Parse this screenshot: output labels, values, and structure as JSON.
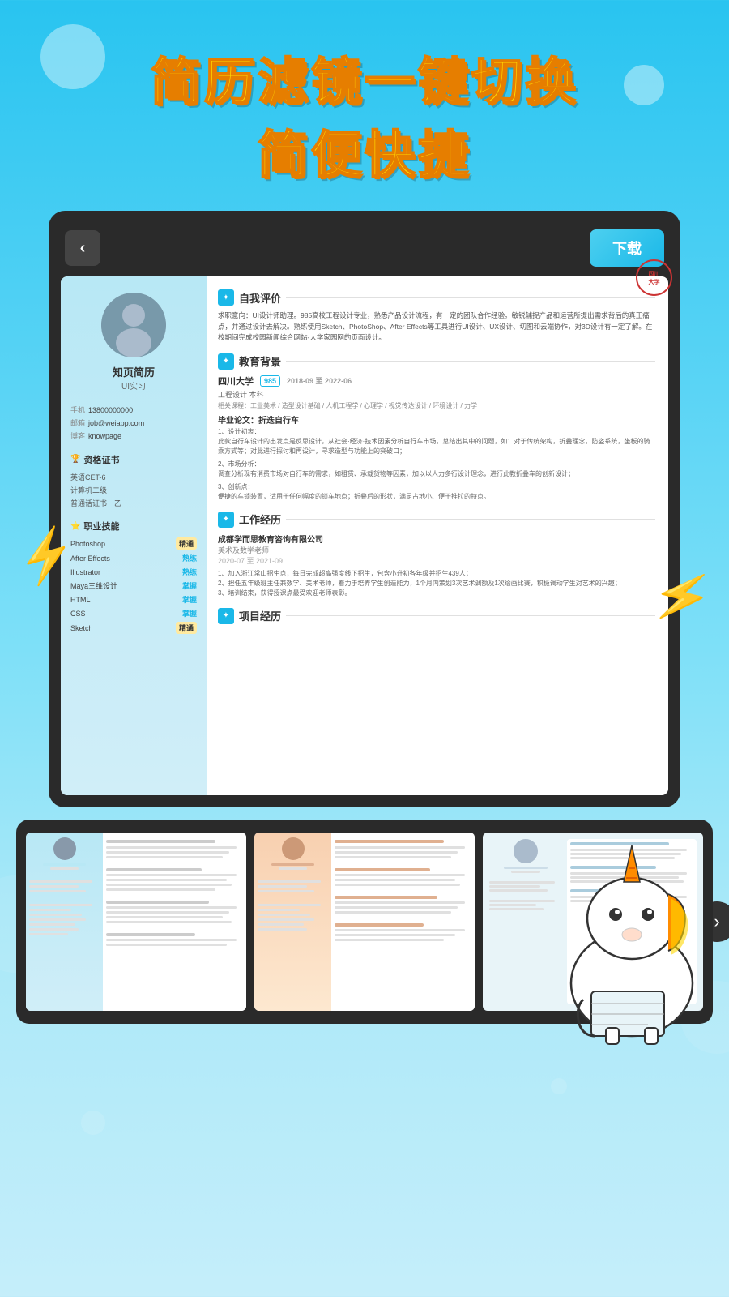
{
  "hero": {
    "line1": "简历滤镜一键切换",
    "line2": "简便快捷"
  },
  "device": {
    "back_label": "‹",
    "download_label": "下载"
  },
  "resume": {
    "brand": "知页简历",
    "brand_sub": "UI实习",
    "contact": {
      "phone_label": "手机",
      "phone": "13800000000",
      "email_label": "邮箱",
      "email": "job@weiapp.com",
      "blog_label": "博客",
      "blog": "knowpage"
    },
    "certs_title": "资格证书",
    "certs": [
      "英语CET-6",
      "计算机二级",
      "普通话证书一乙"
    ],
    "skills_title": "职业技能",
    "skills": [
      {
        "name": "Photoshop",
        "level": "精通",
        "highlight": true
      },
      {
        "name": "After Effects",
        "level": "熟练",
        "highlight": false
      },
      {
        "name": "Illustrator",
        "level": "熟练",
        "highlight": false
      },
      {
        "name": "Maya三维设计",
        "level": "掌握",
        "highlight": false
      },
      {
        "name": "HTML",
        "level": "掌握",
        "highlight": false
      },
      {
        "name": "CSS",
        "level": "掌握",
        "highlight": false
      },
      {
        "name": "Sketch",
        "level": "精通",
        "highlight": true
      }
    ],
    "self_eval_title": "自我评价",
    "self_eval": "求职意向：UI设计师助理。985高校工程设计专业，熟悉产品设计流程，有一定的团队合作经验。敏锐辅捉产品和运营所提出需求背后的真正痛点，并通过设计去解决。熟练使用Sketch、PhotoShop、After Effects等工具进行UI设计、UX设计、切图和云端协作，对3D设计有一定了解。在校期间完成校园新闻综合网站-大学家园网的页面设计。",
    "edu_title": "教育背景",
    "edu": {
      "school": "四川大学",
      "tag": "985",
      "date": "2018-09 至 2022-06",
      "degree": "工程设计 本科",
      "courses": "相关课程：工业美术 / 造型设计基础 / 人机工程学 / 心理学 / 视觉传达设计 / 环境设计 / 力学",
      "project_title": "毕业论文：折迭自行车",
      "project_text1": "1、设计初衷：\n此款自行车设计的出发点是反思设计，从社会·经济·技术因素分析自行车市场，总结出其中的问题，如：对于传统架构，折叠理念，防盗系统，坐板的骑乘方式等；对此进行探讨和再设计，寻求造型与功能上的突破口；",
      "project_text2": "2、市场分析：\n调查分析现有消费市场对自行车的需求，如租赁、承载货物等因素，加以以人力多行设计理念，进行此教折叠车的创新设计；",
      "project_text3": "3、创新点：\n便捷的车锁装置，适用于任何幅度的锁车地点；折叠后的形状，满足占地小、便于推拉的特点。"
    },
    "work_title": "工作经历",
    "work": {
      "company": "成都学而思教育咨询有限公司",
      "role": "美术及数学老师",
      "date": "2020-07 至 2021-09",
      "text1": "1、加入浙江常山招生点，每日完成超高强度线下招生，包含小升初各年级并招生439人；",
      "text2": "2、担任五年级班主任兼数学、美术老师，着力于培养学生创造能力，1个月内策划3次艺术调额及1次绘画比赛，积极调动学生对艺术的兴趣；",
      "text3": "3、培训结束，获得授课点最受欢迎老师表彰。"
    },
    "project_title": "项目经历"
  },
  "thumbnails": [
    {
      "id": 1
    },
    {
      "id": 2
    },
    {
      "id": 3
    }
  ],
  "next_btn_label": "›",
  "lightning_symbol": "⚡"
}
